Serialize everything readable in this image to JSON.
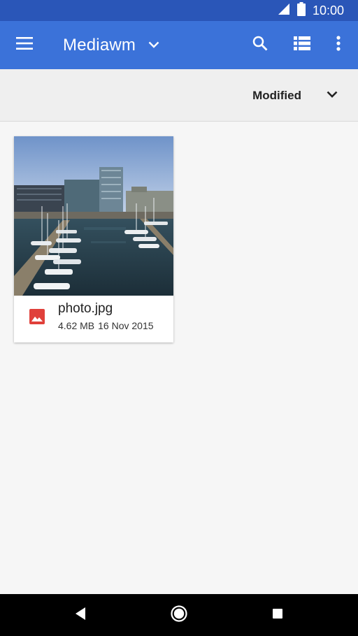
{
  "status_bar": {
    "time": "10:00",
    "icons": [
      "signal-icon",
      "battery-icon"
    ]
  },
  "app_bar": {
    "title": "Mediawm",
    "icons": [
      "menu-icon",
      "chevron-down-icon",
      "search-icon",
      "list-view-icon",
      "more-vert-icon"
    ]
  },
  "sort_bar": {
    "label": "Modified"
  },
  "files": [
    {
      "name": "photo.jpg",
      "size": "4.62 MB",
      "date": "16 Nov 2015",
      "type_icon": "image-icon"
    }
  ],
  "nav_bar": {
    "icons": [
      "back-icon",
      "home-icon",
      "recents-icon"
    ]
  },
  "colors": {
    "status_bar": "#2a56b8",
    "app_bar": "#3b72d9",
    "background": "#f6f6f6",
    "image_icon": "#e0403a"
  }
}
